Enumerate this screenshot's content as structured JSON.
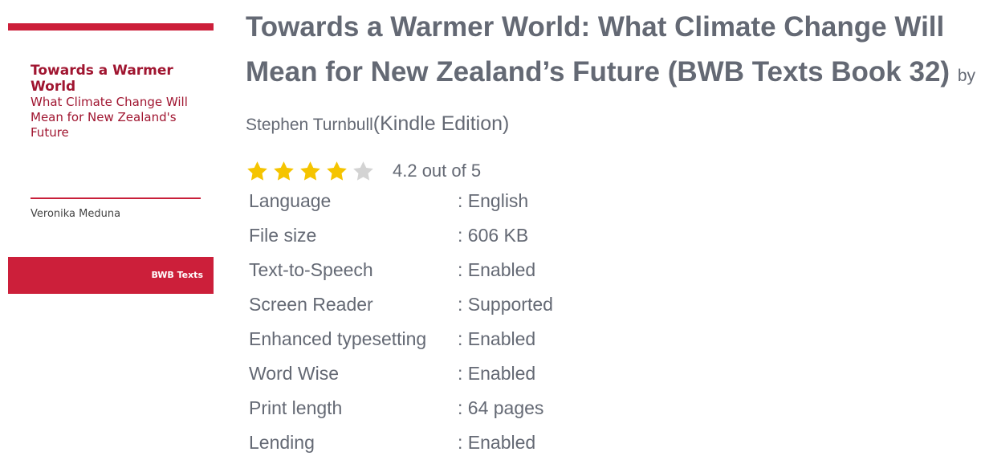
{
  "cover": {
    "title": "Towards a Warmer World",
    "subtitle": "What Climate Change Will Mean for New Zealand's Future",
    "author": "Veronika Meduna",
    "publisher": "BWB Texts"
  },
  "book": {
    "title": "Towards a Warmer World: What Climate Change Will Mean for New Zealand’s Future (BWB Texts Book 32)",
    "by": "by Stephen Turnbull",
    "edition": "(Kindle Edition)"
  },
  "rating": {
    "value": 4.2,
    "max": 5,
    "text": "4.2 out of 5",
    "filled_color": "#f5c400",
    "empty_color": "#d3d3d3"
  },
  "details": [
    {
      "label": "Language",
      "value": ": English"
    },
    {
      "label": "File size",
      "value": ": 606 KB"
    },
    {
      "label": "Text-to-Speech",
      "value": ": Enabled"
    },
    {
      "label": "Screen Reader",
      "value": ": Supported"
    },
    {
      "label": "Enhanced typesetting",
      "value": ": Enabled"
    },
    {
      "label": "Word Wise",
      "value": ": Enabled"
    },
    {
      "label": "Print length",
      "value": ": 64 pages"
    },
    {
      "label": "Lending",
      "value": ": Enabled"
    }
  ]
}
